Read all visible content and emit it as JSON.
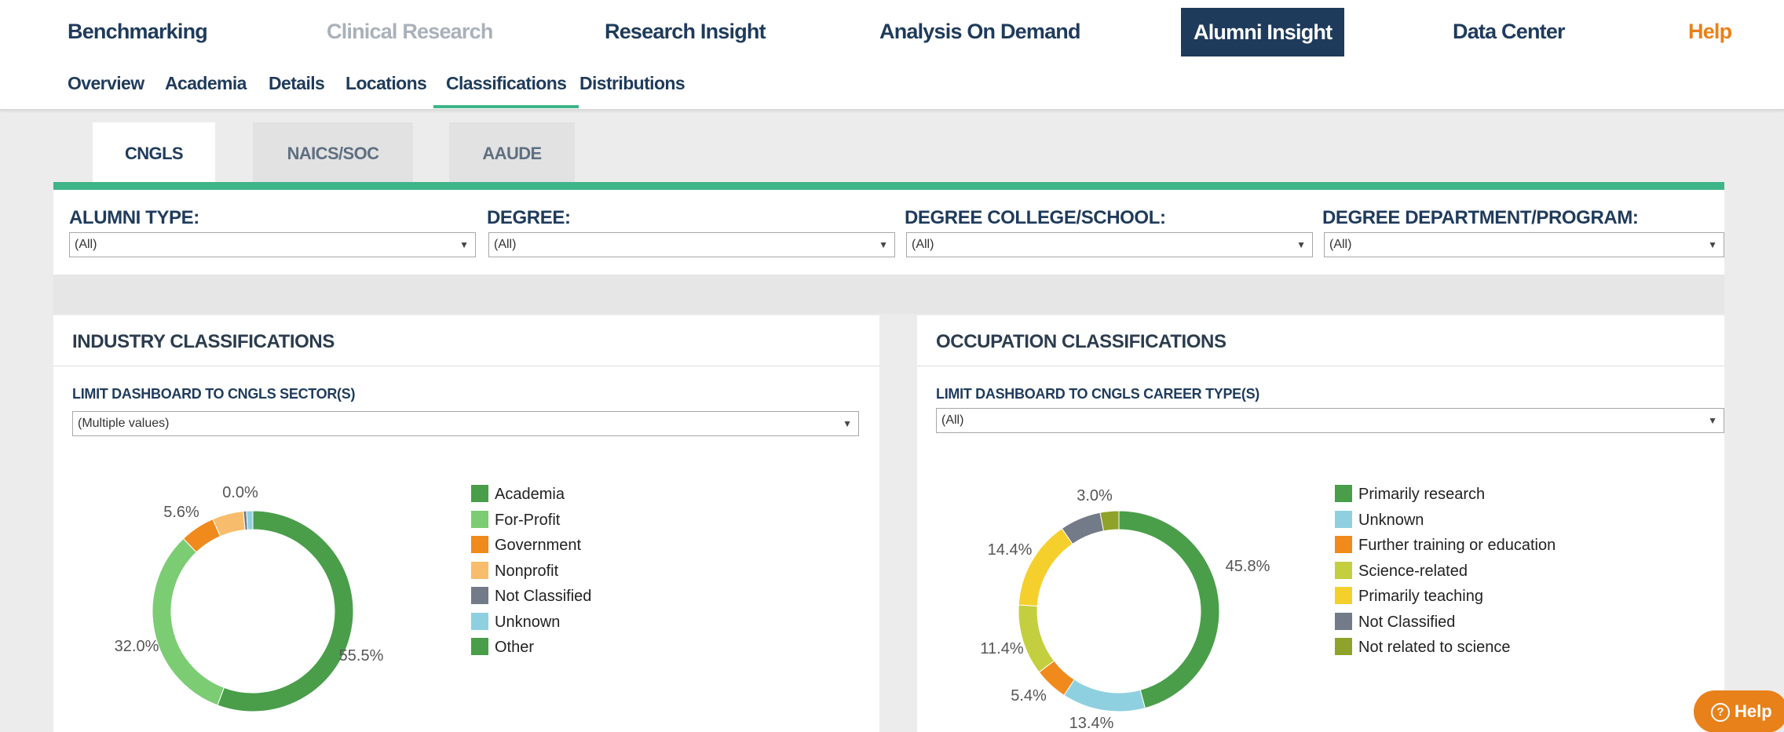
{
  "topnav": {
    "items": [
      {
        "label": "Benchmarking"
      },
      {
        "label": "Clinical Research"
      },
      {
        "label": "Research Insight"
      },
      {
        "label": "Analysis On Demand"
      },
      {
        "label": "Alumni Insight"
      },
      {
        "label": "Data Center"
      },
      {
        "label": "Help"
      }
    ]
  },
  "subnav": {
    "items": [
      {
        "label": "Overview"
      },
      {
        "label": "Academia"
      },
      {
        "label": "Details"
      },
      {
        "label": "Locations"
      },
      {
        "label": "Classifications"
      },
      {
        "label": "Distributions"
      }
    ]
  },
  "tabs": [
    {
      "label": "CNGLS"
    },
    {
      "label": "NAICS/SOC"
    },
    {
      "label": "AAUDE"
    }
  ],
  "filters": [
    {
      "label": "ALUMNI TYPE:",
      "value": "(All)"
    },
    {
      "label": "DEGREE:",
      "value": "(All)"
    },
    {
      "label": "DEGREE COLLEGE/SCHOOL:",
      "value": "(All)"
    },
    {
      "label": "DEGREE DEPARTMENT/PROGRAM:",
      "value": "(All)"
    }
  ],
  "industry": {
    "title": "INDUSTRY CLASSIFICATIONS",
    "limit_label": "LIMIT DASHBOARD TO CNGLS SECTOR(S)",
    "limit_value": "(Multiple values)",
    "legend": [
      {
        "label": "Academia",
        "color": "#4a9e4a"
      },
      {
        "label": "For-Profit",
        "color": "#7ccc74"
      },
      {
        "label": "Government",
        "color": "#f08a1c"
      },
      {
        "label": "Nonprofit",
        "color": "#f7bd6d"
      },
      {
        "label": "Not Classified",
        "color": "#727b87"
      },
      {
        "label": "Unknown",
        "color": "#8fd0e0"
      },
      {
        "label": "Other",
        "color": "#4a9e4a"
      }
    ]
  },
  "occupation": {
    "title": "OCCUPATION CLASSIFICATIONS",
    "limit_label": "LIMIT DASHBOARD TO CNGLS CAREER TYPE(S)",
    "limit_value": "(All)",
    "legend": [
      {
        "label": "Primarily research",
        "color": "#4a9e4a"
      },
      {
        "label": "Unknown",
        "color": "#8fd0e0"
      },
      {
        "label": "Further training or education",
        "color": "#f08a1c"
      },
      {
        "label": "Science-related",
        "color": "#c3cf3e"
      },
      {
        "label": "Primarily teaching",
        "color": "#f5cf2c"
      },
      {
        "label": "Not Classified",
        "color": "#727b87"
      },
      {
        "label": "Not related to science",
        "color": "#8fa32a"
      }
    ]
  },
  "chart_data": [
    {
      "type": "pie",
      "title": "INDUSTRY CLASSIFICATIONS",
      "categories": [
        "Academia",
        "For-Profit",
        "Government",
        "Nonprofit",
        "Not Classified",
        "Unknown",
        "Other"
      ],
      "values": [
        55.5,
        32.0,
        5.6,
        5.0,
        0.5,
        1.0,
        0.0
      ],
      "labels": [
        "55.5%",
        "32.0%",
        "5.6%",
        "",
        "",
        "",
        "0.0%"
      ],
      "colors": [
        "#4a9e4a",
        "#7ccc74",
        "#f08a1c",
        "#f7bd6d",
        "#727b87",
        "#8fd0e0",
        "#4a9e4a"
      ]
    },
    {
      "type": "pie",
      "title": "OCCUPATION CLASSIFICATIONS",
      "categories": [
        "Primarily research",
        "Unknown",
        "Further training or education",
        "Science-related",
        "Primarily teaching",
        "Not Classified",
        "Not related to science"
      ],
      "values": [
        45.8,
        13.4,
        5.4,
        11.4,
        14.4,
        6.6,
        3.0
      ],
      "labels": [
        "45.8%",
        "13.4%",
        "5.4%",
        "11.4%",
        "14.4%",
        "",
        "3.0%"
      ],
      "colors": [
        "#4a9e4a",
        "#8fd0e0",
        "#f08a1c",
        "#c3cf3e",
        "#f5cf2c",
        "#727b87",
        "#8fa32a"
      ]
    }
  ],
  "help_button": {
    "label": "Help"
  }
}
